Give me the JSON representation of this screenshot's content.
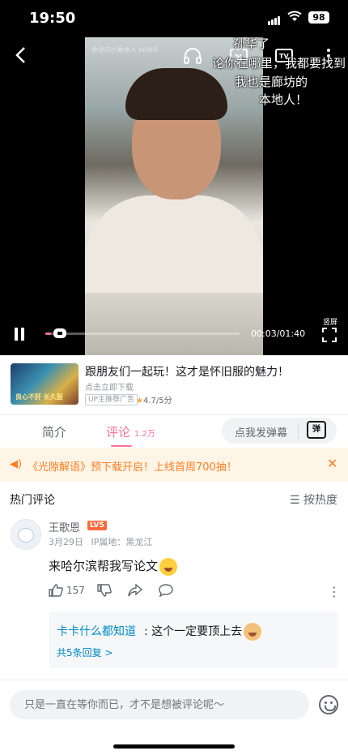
{
  "status_bar": {
    "time": "19:50",
    "battery": "98"
  },
  "video": {
    "watermark": "会说的小颖本人 bilibili",
    "overlay_lines": [
      "孙华了",
      "论你在哪里，我都要找到",
      "我也是廊坊的",
      "本地人！"
    ],
    "time_current": "00:03",
    "time_total": "01:40",
    "time_display": "00:03/01:40",
    "progress": 0.03,
    "vertical_label": "竖屏"
  },
  "ad": {
    "title": "跟朋友们一起玩！这才是怀旧服的魅力！",
    "subtitle": "点击立即下载",
    "tag": "UP主推荐广告",
    "rating": "4.7/5分",
    "thumb_text": "良心不肝 长久服"
  },
  "tabs": [
    {
      "label": "简介",
      "count": ""
    },
    {
      "label": "评论",
      "count": "1.2万"
    }
  ],
  "danmaku": {
    "placeholder": "点我发弹幕",
    "icon_text": "弹"
  },
  "notice": {
    "text": "《光隙解语》预下载开启！上线首周700抽！"
  },
  "comments_header": {
    "title": "热门评论",
    "sort": "按热度"
  },
  "comment": {
    "username": "王歌恩",
    "level": "LV5",
    "date": "3月29日",
    "location": "IP属地：黑龙江",
    "text": "来哈尔滨帮我写论文",
    "likes": "157",
    "reply": {
      "author": "卡卡什么都知道",
      "text": ": 这个一定要顶上去",
      "count": "共5条回复 >"
    }
  },
  "input": {
    "placeholder": "只是一直在等你而已，才不是想被评论呢～"
  },
  "colors": {
    "accent": "#fb7299",
    "link": "#008ac5",
    "notice": "#ff7f24"
  }
}
